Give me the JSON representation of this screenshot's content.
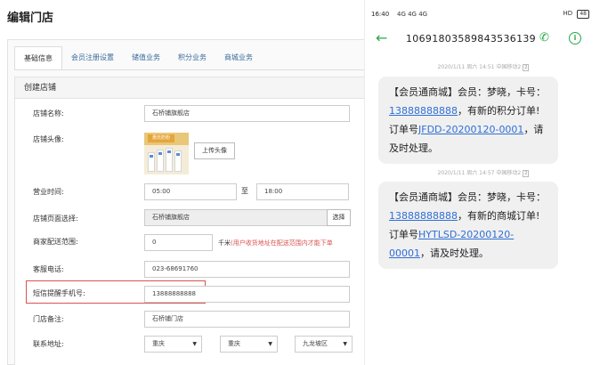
{
  "admin": {
    "title": "编辑门店",
    "tabs": [
      {
        "label": "基础信息",
        "active": true
      },
      {
        "label": "会员注册设置",
        "active": false
      },
      {
        "label": "储值业务",
        "active": false
      },
      {
        "label": "积分业务",
        "active": false
      },
      {
        "label": "商城业务",
        "active": false
      }
    ],
    "section_title": "创建店铺",
    "fields": {
      "store_name": {
        "label": "店铺名称:",
        "value": "石桥铺旗舰店"
      },
      "avatar": {
        "label": "店铺头像:",
        "upload_label": "上传头像",
        "image_tag": "惠氏奶粉"
      },
      "hours": {
        "label": "营业时间:",
        "start": "05:00",
        "separator": "至",
        "end": "18:00"
      },
      "page_select": {
        "label": "店铺页面选择:",
        "value": "石桥铺旗舰店",
        "button": "选择"
      },
      "delivery_range": {
        "label": "商家配送范围:",
        "value": "0",
        "unit": "千米",
        "hint": "(用户收货地址在配送范围内才能下单"
      },
      "phone": {
        "label": "客服电话:",
        "value": "023-68691760"
      },
      "sms_phone": {
        "label": "短信提醒手机号:",
        "value": "13888888888"
      },
      "note": {
        "label": "门店备注:",
        "value": "石桥铺门店"
      },
      "address": {
        "label": "联系地址:",
        "province": "重庆",
        "city": "重庆",
        "district": "九龙坡区"
      }
    }
  },
  "phone": {
    "status": {
      "time": "16:40",
      "signal": "4G 4G 4G",
      "right": "HD",
      "battery": "48"
    },
    "sender_number": "10691803589843536139",
    "messages": [
      {
        "timestamp": "2020/1/11 周六 14:51  中国移动2",
        "sim": "2",
        "prefix": "【会员通商城】会员：梦晓，卡号：",
        "phone_link": "13888888888",
        "middle": "，有新的积分订单!订单号",
        "order_link": "JFDD-20200120-0001",
        "suffix": "，请及时处理。"
      },
      {
        "timestamp": "2020/1/11 周六 14:57  中国移动2",
        "sim": "2",
        "prefix": "【会员通商城】会员：梦晓，卡号：",
        "phone_link": "13888888888",
        "middle": "，有新的商城订单!订单号",
        "order_link": "HYTLSD-20200120-00001",
        "suffix": "，请及时处理。"
      }
    ]
  },
  "colors": {
    "accent_green": "#2aa84a",
    "link_blue": "#2f6fd6",
    "alert_red": "#d9534f",
    "tab_blue": "#3a6a9c"
  }
}
